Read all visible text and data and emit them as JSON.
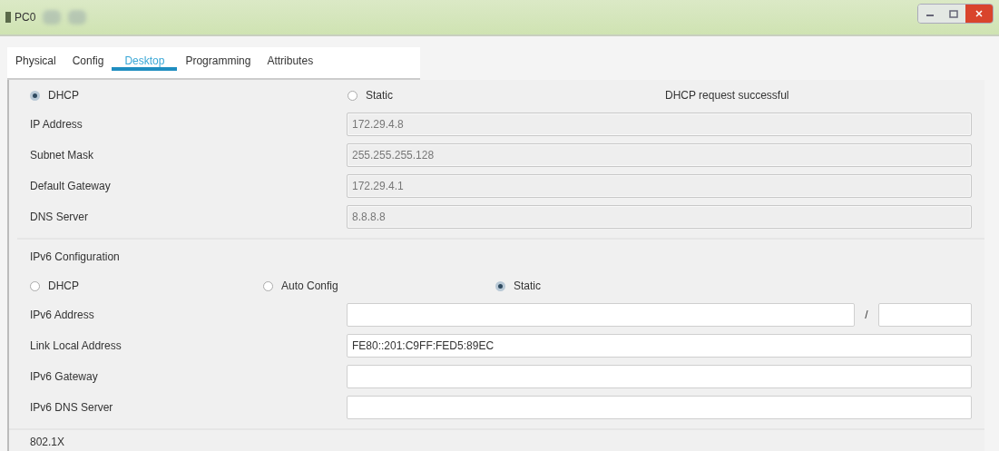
{
  "window": {
    "title": "PC0"
  },
  "tabs": [
    {
      "label": "Physical",
      "selected": false
    },
    {
      "label": "Config",
      "selected": false
    },
    {
      "label": "Desktop",
      "selected": true
    },
    {
      "label": "Programming",
      "selected": false
    },
    {
      "label": "Attributes",
      "selected": false
    }
  ],
  "ipv4": {
    "modes": [
      {
        "label": "DHCP",
        "selected": true
      },
      {
        "label": "Static",
        "selected": false
      }
    ],
    "status": "DHCP request successful",
    "fields": [
      {
        "label": "IP Address",
        "value": "172.29.4.8",
        "disabled": true
      },
      {
        "label": "Subnet Mask",
        "value": "255.255.255.128",
        "disabled": true
      },
      {
        "label": "Default Gateway",
        "value": "172.29.4.1",
        "disabled": true
      },
      {
        "label": "DNS Server",
        "value": "8.8.8.8",
        "disabled": true
      }
    ]
  },
  "ipv6": {
    "heading": "IPv6 Configuration",
    "modes": [
      {
        "label": "DHCP",
        "selected": false
      },
      {
        "label": "Auto Config",
        "selected": false
      },
      {
        "label": "Static",
        "selected": true
      }
    ],
    "fields": [
      {
        "label": "IPv6 Address",
        "kind": "prefix",
        "separator": "/",
        "disabled": false
      },
      {
        "label": "Link Local Address",
        "kind": "plain",
        "value": "FE80::201:C9FF:FED5:89EC",
        "disabled": false
      },
      {
        "label": "IPv6 Gateway",
        "kind": "plain",
        "disabled": false
      },
      {
        "label": "IPv6 DNS Server",
        "kind": "plain",
        "disabled": false
      }
    ]
  },
  "next_section": "802.1X"
}
